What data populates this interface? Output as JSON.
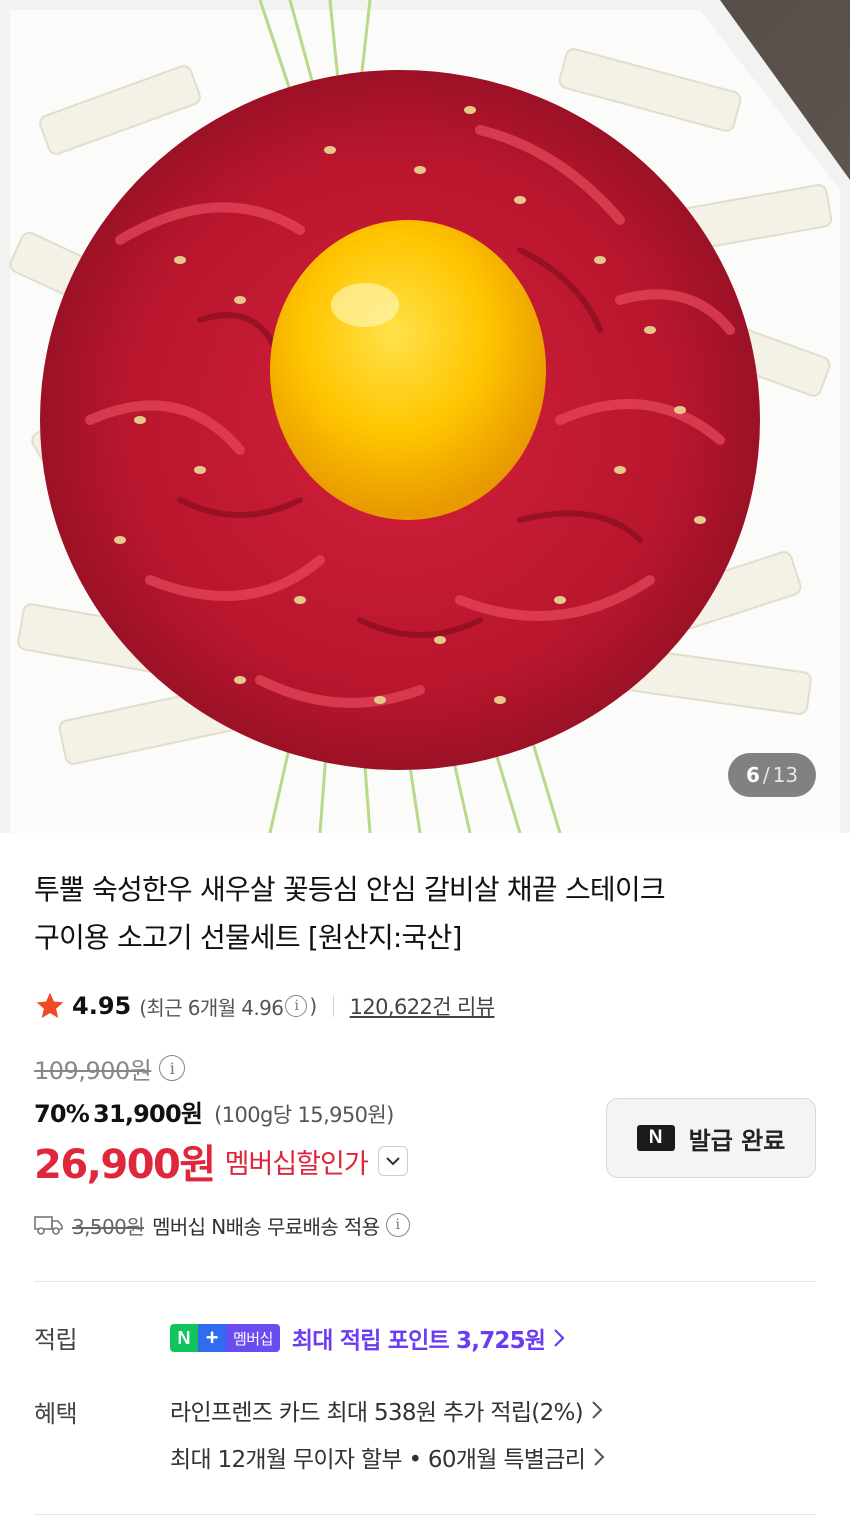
{
  "gallery": {
    "current": "6",
    "separator": "/",
    "total": "13"
  },
  "product": {
    "title_line1": "투뿔 숙성한우 새우살 꽃등심 안심 갈비살 채끝 스테이크",
    "title_line2": "구이용 소고기 선물세트 [원산지:국산]",
    "rating": "4.95",
    "recent_rating": "(최근 6개월 4.96",
    "recent_rating_close": ")",
    "review_count": "120,622건 리뷰",
    "original_price": "109,900원",
    "discount_rate": "70%",
    "sale_price": "31,900원",
    "unit_price": "(100g당 15,950원)",
    "member_price": "26,900원",
    "member_price_label": "멤버십할인가",
    "coupon_button": {
      "badge": "N",
      "label": "발급 완료"
    },
    "shipping": {
      "original_fee": "3,500원",
      "text": "멤버십 N배송 무료배송 적용"
    }
  },
  "benefits": {
    "points_label": "적립",
    "membership_badge": {
      "n": "N",
      "plus": "+",
      "text": "멤버십"
    },
    "points_text": "최대 적립 포인트 3,725원",
    "benefit_label": "혜택",
    "benefit_lines": [
      "라인프렌즈 카드 최대 538원 추가 적립(2%)",
      "최대 12개월 무이자 할부 • 60개월 특별금리"
    ]
  },
  "colors": {
    "member_price": "#e0263a",
    "points": "#6b3cf0",
    "star": "#f04a24"
  },
  "icons": [
    "star-icon",
    "info-icon",
    "chevron-down-icon",
    "truck-icon",
    "chevron-right-icon"
  ]
}
